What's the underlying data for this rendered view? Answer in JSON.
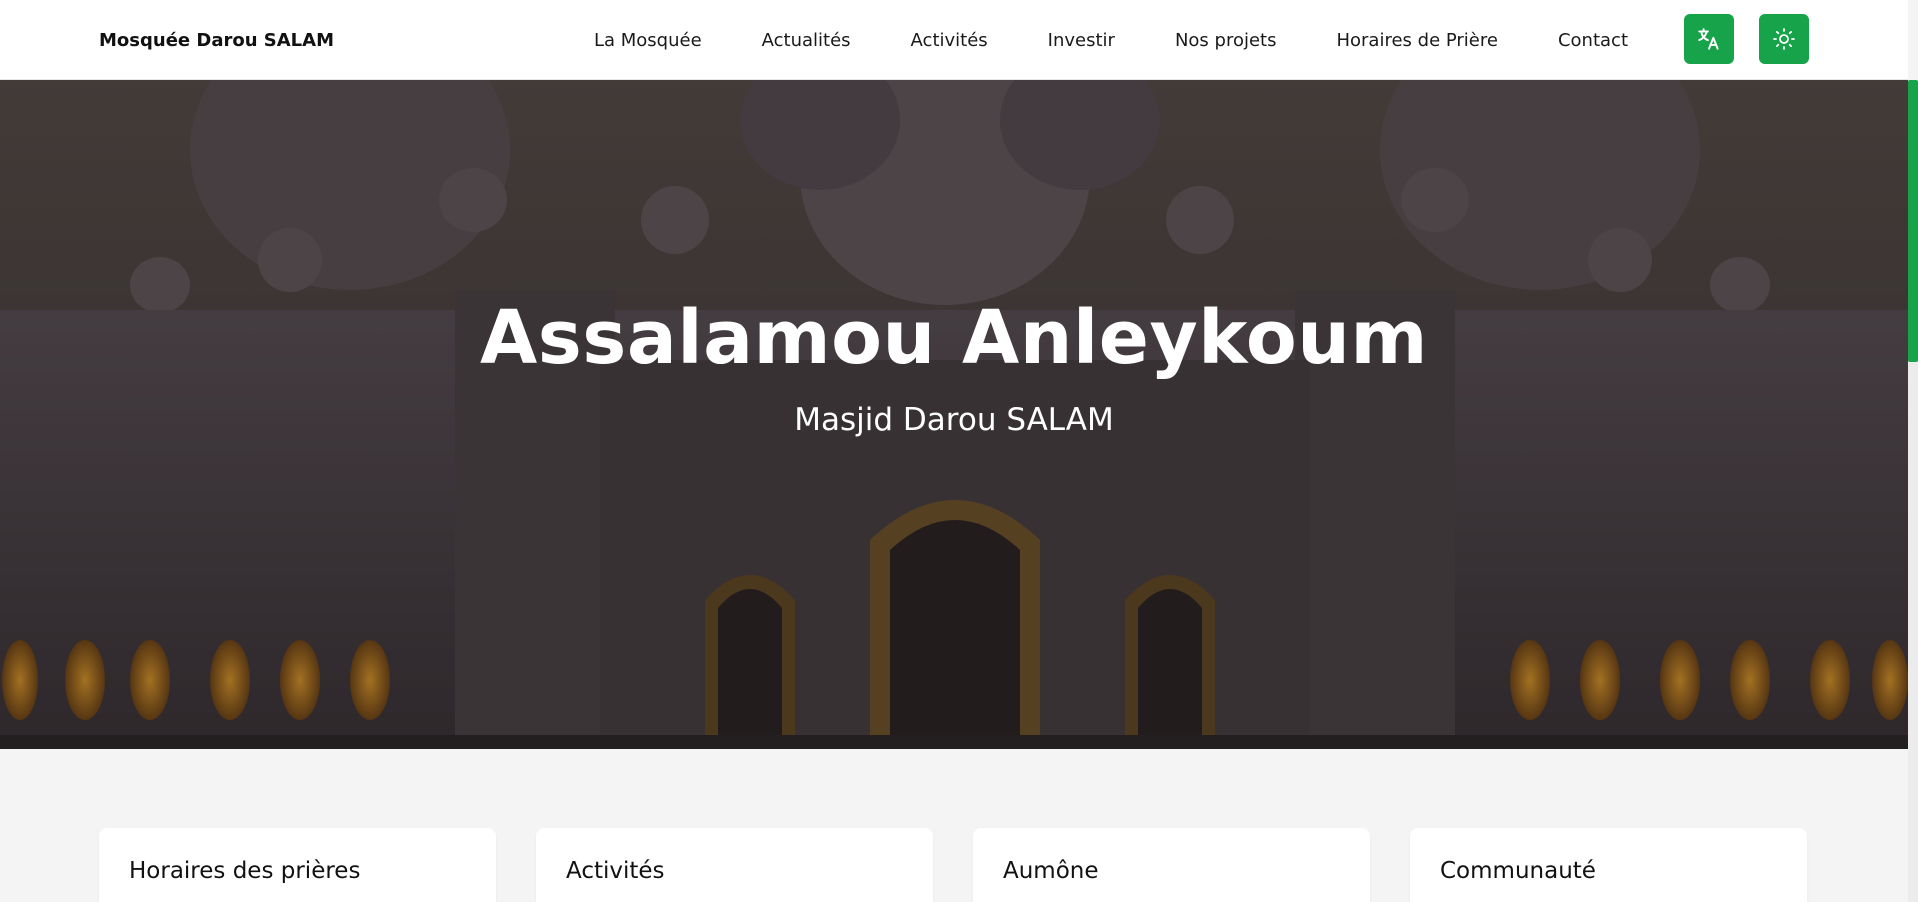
{
  "header": {
    "brand": "Mosquée Darou SALAM",
    "nav": [
      "La Mosquée",
      "Actualités",
      "Activités",
      "Investir",
      "Nos projets",
      "Horaires de Prière",
      "Contact"
    ],
    "translate_icon": "translate-icon",
    "theme_icon": "sun-icon"
  },
  "hero": {
    "title": "Assalamou Anleykoum",
    "subtitle": "Masjid Darou SALAM"
  },
  "cards": [
    {
      "title": "Horaires des prières"
    },
    {
      "title": "Activités"
    },
    {
      "title": "Aumône"
    },
    {
      "title": "Communauté"
    }
  ],
  "colors": {
    "accent": "#16a34a"
  }
}
